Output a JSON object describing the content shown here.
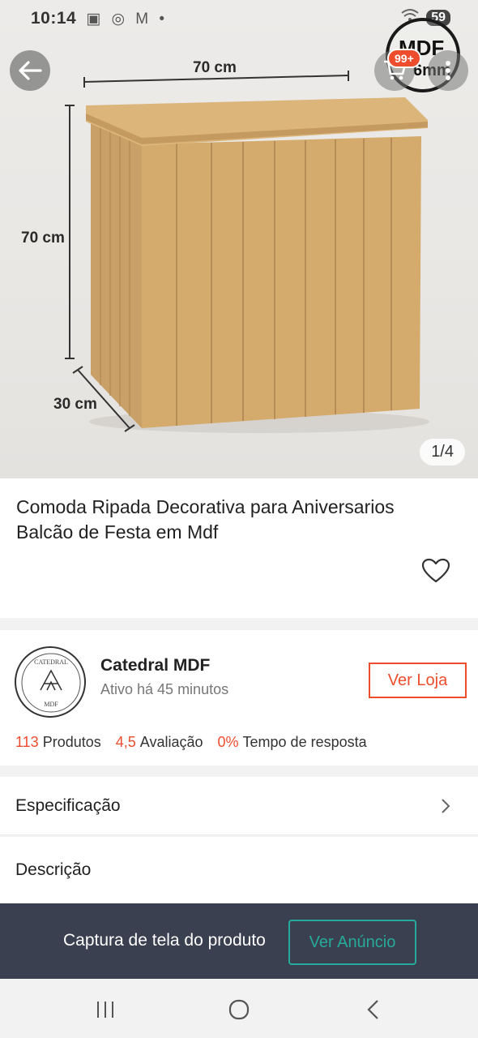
{
  "status_bar": {
    "time": "10:14",
    "notif_icons": "▣ ◎ M •",
    "battery": "59"
  },
  "hero": {
    "dim_width": "70 cm",
    "dim_height": "70 cm",
    "dim_depth": "30 cm",
    "watermark_line1": "MDF",
    "watermark_line2": "6mm",
    "page_indicator": "1/4",
    "cart_badge": "99+"
  },
  "product": {
    "title": "Comoda Ripada Decorativa para Aniversarios Balcão de Festa em Mdf"
  },
  "shop": {
    "logo_text": "CATEDRAL",
    "logo_sub": "MDF",
    "name": "Catedral MDF",
    "status": "Ativo há 45 minutos",
    "visit_label": "Ver Loja",
    "stats": [
      {
        "value": "113",
        "label": "Produtos"
      },
      {
        "value": "4,5",
        "label": "Avaliação"
      },
      {
        "value": "0%",
        "label": "Tempo de resposta"
      }
    ]
  },
  "sections": {
    "spec_label": "Especificação",
    "desc_label": "Descrição"
  },
  "banner": {
    "text": "Captura de tela do produto",
    "button": "Ver Anúncio"
  },
  "colors": {
    "accent": "#ee4d2d",
    "teal": "#26aa99",
    "banner_bg": "#3b4050",
    "wood": "#d2a86c"
  }
}
